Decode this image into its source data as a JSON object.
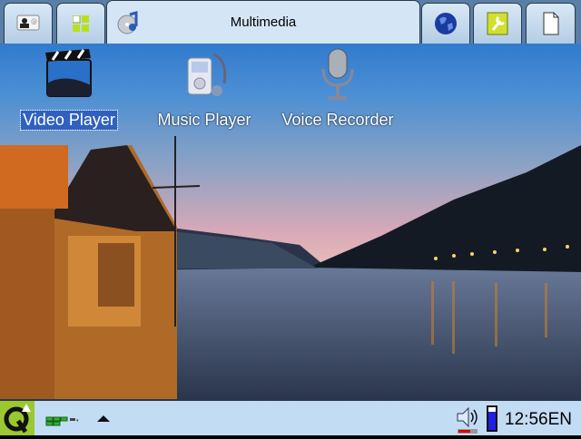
{
  "topbar": {
    "tabs": [
      {
        "icon": "contacts-icon"
      },
      {
        "icon": "applications-grid-icon"
      },
      {
        "icon": "multimedia-icon",
        "title": "Multimedia",
        "active": true
      },
      {
        "icon": "internet-globe-icon"
      },
      {
        "icon": "settings-wrench-icon"
      },
      {
        "icon": "documents-icon"
      }
    ]
  },
  "desktop": {
    "items": [
      {
        "label": "Video Player",
        "icon": "video-clapper-icon",
        "selected": true
      },
      {
        "label": "Music Player",
        "icon": "music-player-icon"
      },
      {
        "label": "Voice Recorder",
        "icon": "microphone-icon"
      }
    ]
  },
  "taskbar": {
    "clock": "12:56",
    "lang": "EN",
    "volume_level": 0.6,
    "battery_level": 0.8
  }
}
